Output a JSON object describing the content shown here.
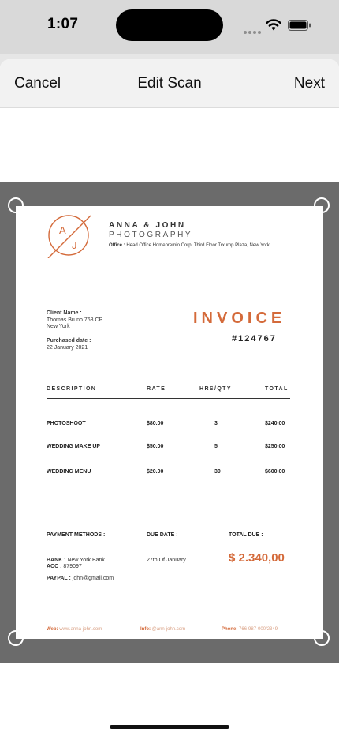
{
  "status_bar": {
    "time": "1:07"
  },
  "nav": {
    "cancel": "Cancel",
    "title": "Edit Scan",
    "next": "Next"
  },
  "invoice": {
    "logo_letters": [
      "A",
      "J"
    ],
    "brand_line1": "ANNA & JOHN",
    "brand_line2": "PHOTOGRAPHY",
    "office_label": "Office :",
    "office_text": "Head Office Homepremio Corp, Third Floor Trxump Plaza, New York",
    "client_label": "Client Name :",
    "client_name": "Thomas Bruno 768 CP",
    "client_city": "New York",
    "purchased_label": "Purchased date :",
    "purchased_date": "22 January 2021",
    "title": "INVOICE",
    "number": "#124767",
    "headers": [
      "DESCRIPTION",
      "RATE",
      "HRS/QTY",
      "TOTAL"
    ],
    "rows": [
      {
        "desc": "PHOTOSHOOT",
        "rate": "$80.00",
        "qty": "3",
        "total": "$240.00"
      },
      {
        "desc": "WEDDING MAKE UP",
        "rate": "$50.00",
        "qty": "5",
        "total": "$250.00"
      },
      {
        "desc": "WEDDING MENU",
        "rate": "$20.00",
        "qty": "30",
        "total": "$600.00"
      }
    ],
    "payment_label": "PAYMENT METHODS :",
    "due_label": "DUE DATE :",
    "total_label": "TOTAL DUE :",
    "bank_label": "BANK :",
    "bank_value": "New York Bank",
    "acc_label": "ACC :",
    "acc_value": "879097",
    "paypal_label": "PAYPAL :",
    "paypal_value": "john@gmail.com",
    "due_value": "27th Of January",
    "total_value": "$ 2.340,00",
    "footer": {
      "web_label": "Web:",
      "web_value": "www.anna-john.com",
      "info_label": "Info:",
      "info_value": "@ann-john.com",
      "phone_label": "Phone:",
      "phone_value": "766-987-000/2349"
    },
    "accent_color": "#d46a3a"
  },
  "icons": [
    "wifi-icon",
    "battery-icon",
    "cellular-signal-icon",
    "crop-handle-icon"
  ]
}
